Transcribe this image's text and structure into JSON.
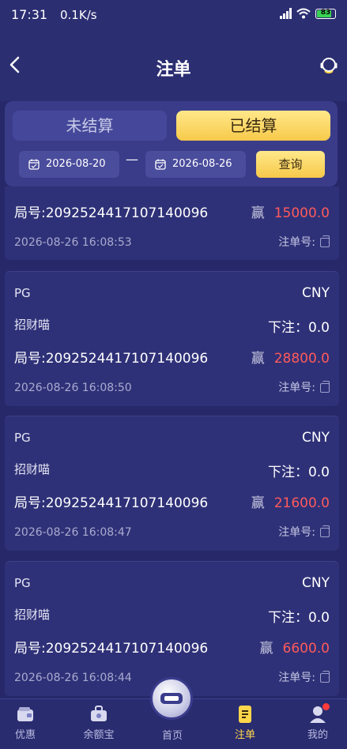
{
  "status": {
    "time": "17:31",
    "speed": "0.1K/s",
    "battery": "83"
  },
  "header": {
    "title": "注单"
  },
  "filter": {
    "tab_unsettled": "未结算",
    "tab_settled": "已结算",
    "date_start": "2026-08-20",
    "date_sep": "—",
    "date_end": "2026-08-26",
    "query": "查询"
  },
  "records": [
    {
      "round": "局号:2092524417107140096",
      "win_label": "赢",
      "amount": "15000.0",
      "time": "2026-08-26 16:08:53",
      "order_label": "注单号:"
    },
    {
      "provider": "PG",
      "currency": "CNY",
      "game": "招财喵",
      "bet": "下注：0.0",
      "round": "局号:2092524417107140096",
      "win_label": "赢",
      "amount": "28800.0",
      "time": "2026-08-26 16:08:50",
      "order_label": "注单号:"
    },
    {
      "provider": "PG",
      "currency": "CNY",
      "game": "招财喵",
      "bet": "下注：0.0",
      "round": "局号:2092524417107140096",
      "win_label": "赢",
      "amount": "21600.0",
      "time": "2026-08-26 16:08:47",
      "order_label": "注单号:"
    },
    {
      "provider": "PG",
      "currency": "CNY",
      "game": "招财喵",
      "bet": "下注：0.0",
      "round": "局号:2092524417107140096",
      "win_label": "赢",
      "amount": "6600.0",
      "time": "2026-08-26 16:08:44",
      "order_label": "注单号:"
    }
  ],
  "tabbar": {
    "promo": "优惠",
    "balance": "余额宝",
    "home": "首页",
    "bets": "注单",
    "mine": "我的"
  }
}
